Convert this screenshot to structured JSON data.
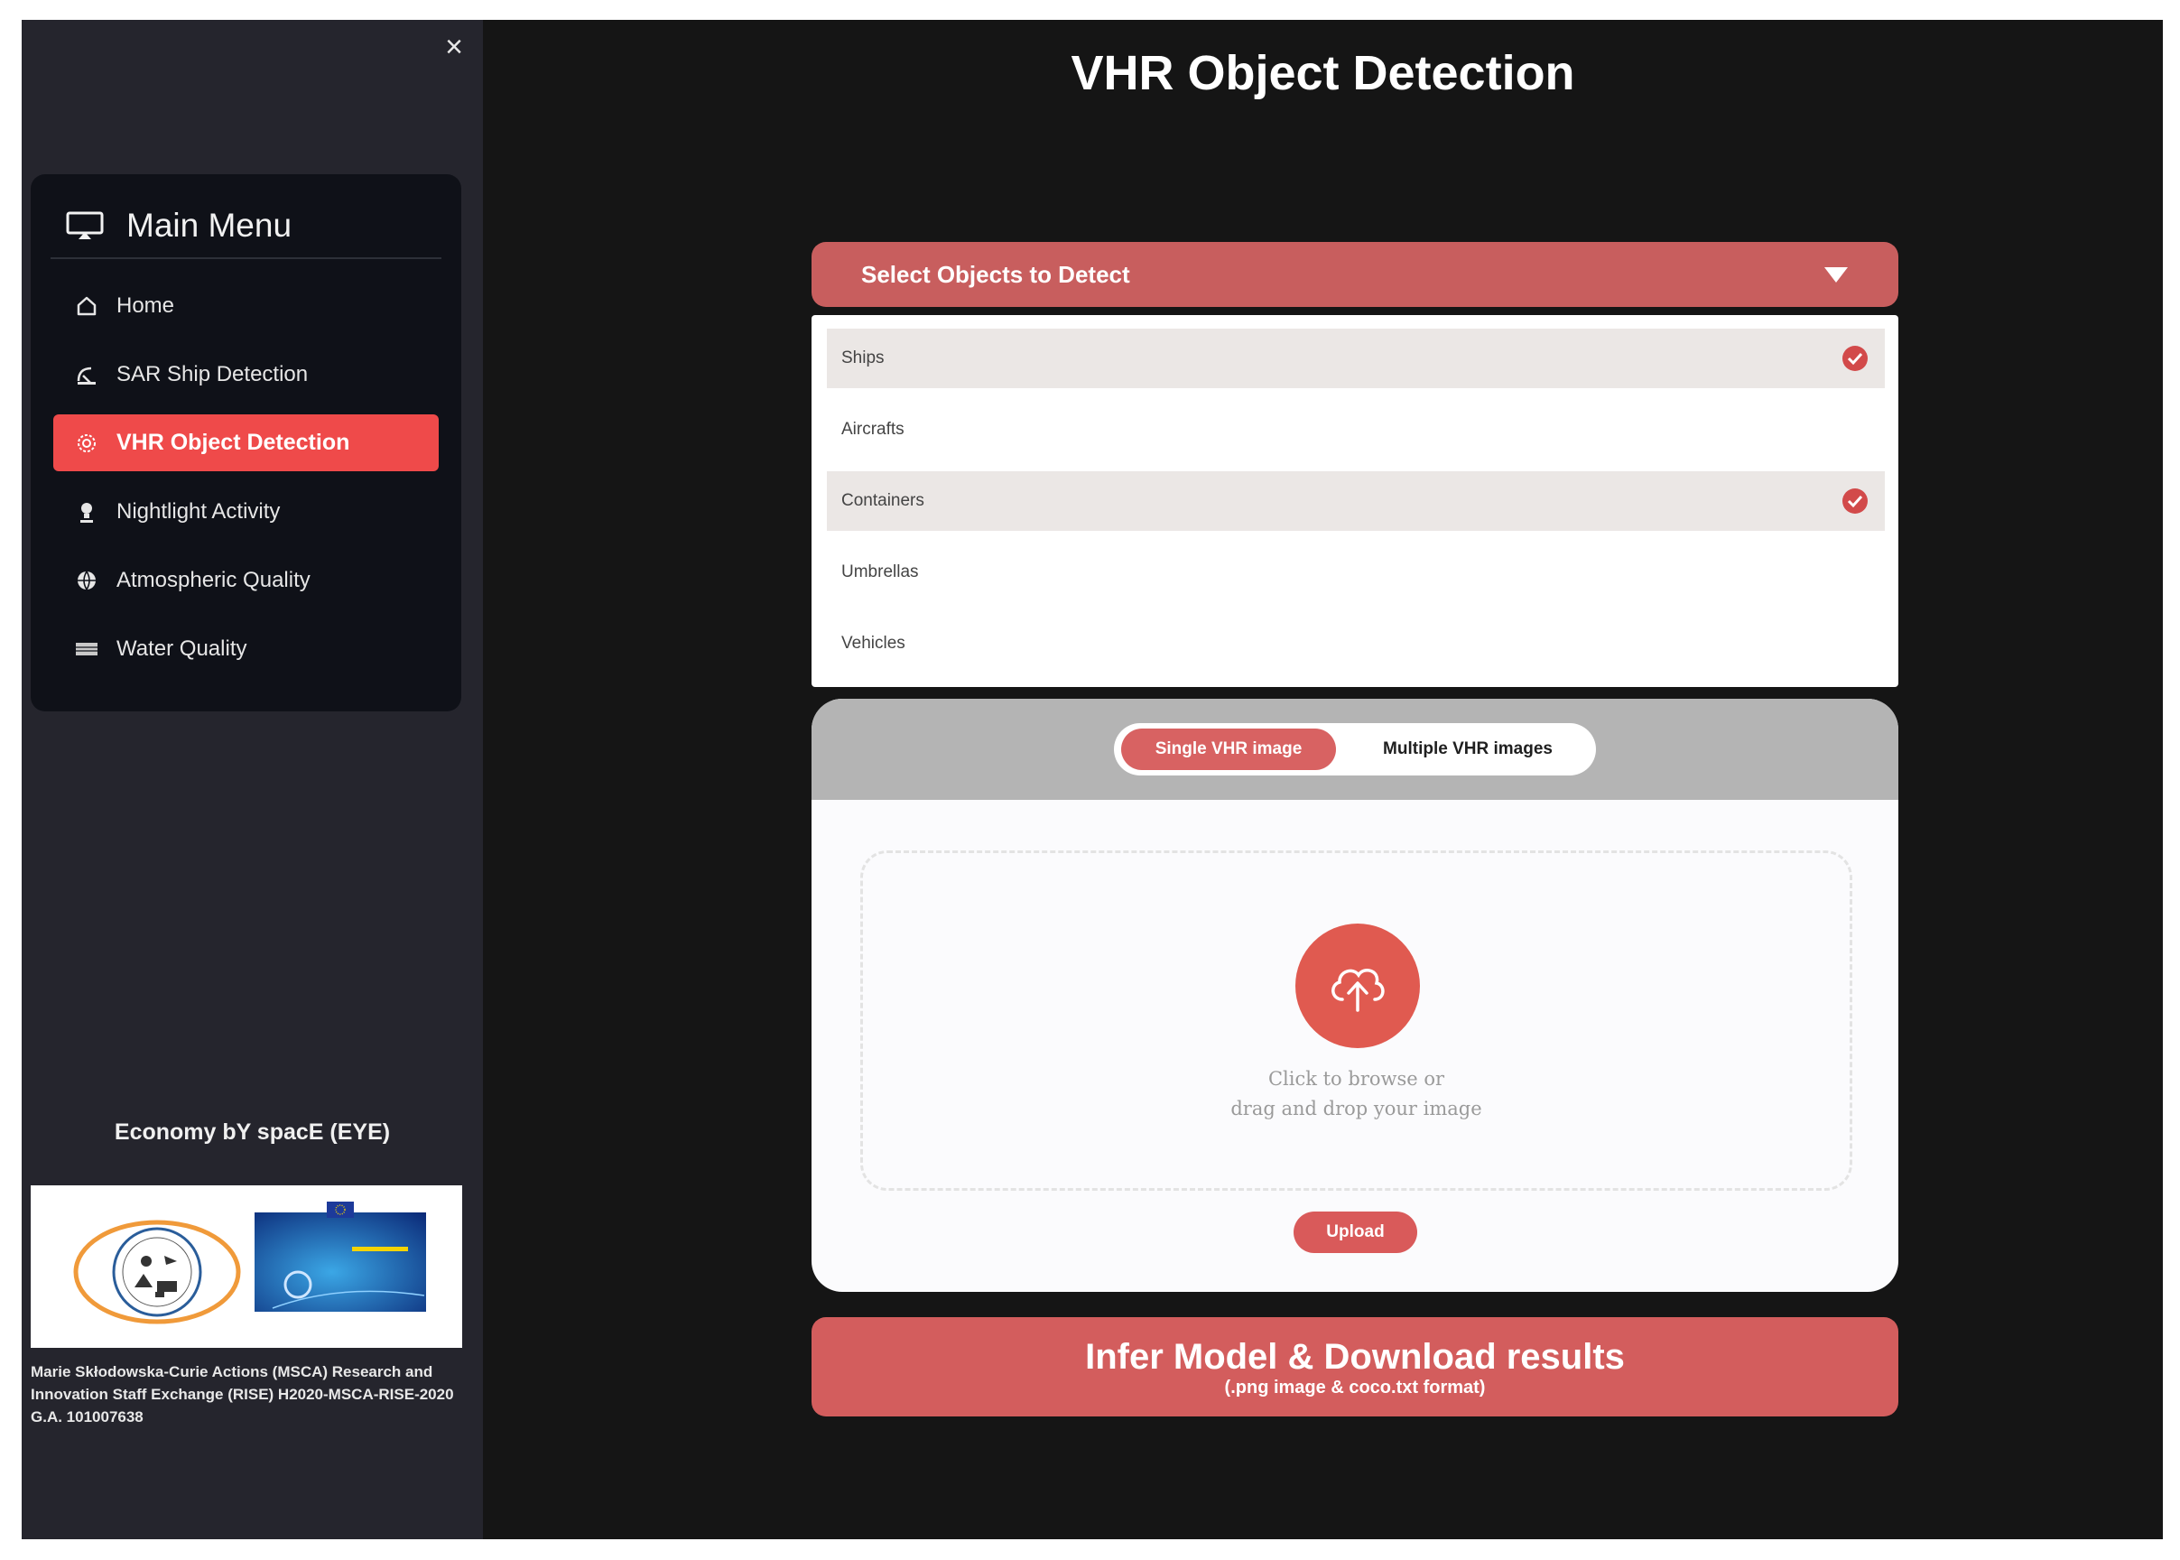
{
  "sidebar": {
    "close_symbol": "×",
    "menu_title": "Main Menu",
    "menu_icon": "monitor-icon",
    "items": [
      {
        "label": "Home",
        "icon": "home-icon",
        "active": false
      },
      {
        "label": "SAR Ship Detection",
        "icon": "satellite-dish-icon",
        "active": false
      },
      {
        "label": "VHR Object Detection",
        "icon": "target-gear-icon",
        "active": true
      },
      {
        "label": "Nightlight Activity",
        "icon": "lamp-icon",
        "active": false
      },
      {
        "label": "Atmospheric Quality",
        "icon": "globe-icon",
        "active": false
      },
      {
        "label": "Water Quality",
        "icon": "water-icon",
        "active": false
      }
    ],
    "project_title": "Economy bY spacE (EYE)",
    "funding_text": "Marie Skłodowska-Curie Actions (MSCA) Research and Innovation Staff Exchange (RISE) H2020-MSCA-RISE-2020 G.A. 101007638",
    "logos": [
      "eye-project-logo",
      "horizon-2020-logo"
    ]
  },
  "main": {
    "title": "VHR Object Detection",
    "select": {
      "label": "Select Objects to Detect",
      "options": [
        {
          "label": "Ships",
          "selected": true
        },
        {
          "label": "Aircrafts",
          "selected": false
        },
        {
          "label": "Containers",
          "selected": true
        },
        {
          "label": "Umbrellas",
          "selected": false
        },
        {
          "label": "Vehicles",
          "selected": false
        }
      ]
    },
    "upload": {
      "tabs": [
        "Single VHR image",
        "Multiple VHR images"
      ],
      "active_tab": "Single VHR image",
      "drop_line1": "Click to browse or",
      "drop_line2": "drag and drop your image",
      "upload_label": "Upload"
    },
    "infer": {
      "label": "Infer Model & Download results",
      "sub": "(.png image & coco.txt format)"
    }
  },
  "colors": {
    "accent": "#c85e5e",
    "active_menu": "#ef4a4a",
    "background": "#151515",
    "sidebar": "#25252d"
  }
}
